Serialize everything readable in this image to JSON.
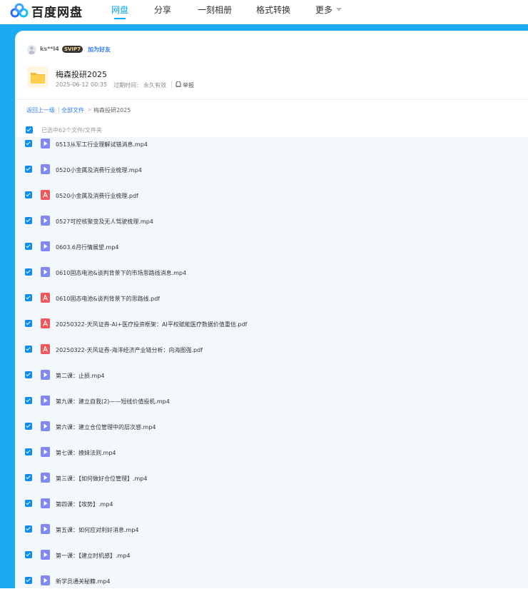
{
  "app": {
    "logo_text": "百度网盘"
  },
  "nav": {
    "tabs": [
      {
        "label": "网盘",
        "active": true
      },
      {
        "label": "分享",
        "active": false
      },
      {
        "label": "一刻相册",
        "active": false
      },
      {
        "label": "格式转换",
        "active": false
      },
      {
        "label": "更多",
        "active": false
      }
    ]
  },
  "sharer": {
    "name": "ks**l4",
    "badge": "SVIP7",
    "add_friend": "加为好友"
  },
  "folder": {
    "title": "梅森投研2025",
    "date": "2025-06-12 00:35",
    "expire_label": "过期时间:",
    "expire_value": "永久有效",
    "report": "举报"
  },
  "breadcrumb": {
    "back": "返回上一级",
    "sep1": "|",
    "all": "全部文件",
    "sep2": ">",
    "current": "梅森投研2025"
  },
  "selection": {
    "text": "已选中62个文件/文件夹",
    "checked": true
  },
  "colors": {
    "accent": "#06a7ff",
    "band": "#1aabf3",
    "checkbox": "#0d8ef0",
    "video_icon": "#7f88f5",
    "pdf_icon": "#f2565a"
  },
  "files": [
    {
      "name": "0513从军工行业理解试错消息.mp4",
      "type": "video",
      "checked": true
    },
    {
      "name": "0520小金属及消费行业梳理.mp4",
      "type": "video",
      "checked": true
    },
    {
      "name": "0520小金属及消费行业梳理.pdf",
      "type": "pdf",
      "checked": true
    },
    {
      "name": "0527可控核聚变及无人驾驶梳理.mp4",
      "type": "video",
      "checked": true
    },
    {
      "name": "0603.6月行情展望.mp4",
      "type": "video",
      "checked": true
    },
    {
      "name": "0610固态电池&谈判背景下的市场思路线消息.mp4",
      "type": "video",
      "checked": true
    },
    {
      "name": "0610固态电池&谈判背景下的思路线.pdf",
      "type": "pdf",
      "checked": true
    },
    {
      "name": "20250322-天风证券-AI+医疗投资框架：AI平权赋能医疗数据价值重估.pdf",
      "type": "pdf",
      "checked": true
    },
    {
      "name": "20250322-天风证券-海洋经济产业链分析：向海图强.pdf",
      "type": "pdf",
      "checked": true
    },
    {
      "name": "第二课：止损.mp4",
      "type": "video",
      "checked": true
    },
    {
      "name": "第九课：建立自我(2)——短线价值投机.mp4",
      "type": "video",
      "checked": true
    },
    {
      "name": "第六课：建立仓位管理中的层次感.mp4",
      "type": "video",
      "checked": true
    },
    {
      "name": "第七课：撩妹法则.mp4",
      "type": "video",
      "checked": true
    },
    {
      "name": "第三课：【如何做好仓位管理】.mp4",
      "type": "video",
      "checked": true
    },
    {
      "name": "第四课：【攻势】.mp4",
      "type": "video",
      "checked": true
    },
    {
      "name": "第五课：如何应对利好消息.mp4",
      "type": "video",
      "checked": true
    },
    {
      "name": "第一课：【建立时机感】.mp4",
      "type": "video",
      "checked": true
    },
    {
      "name": "新学员通关秘籍.mp4",
      "type": "video",
      "checked": true
    }
  ]
}
